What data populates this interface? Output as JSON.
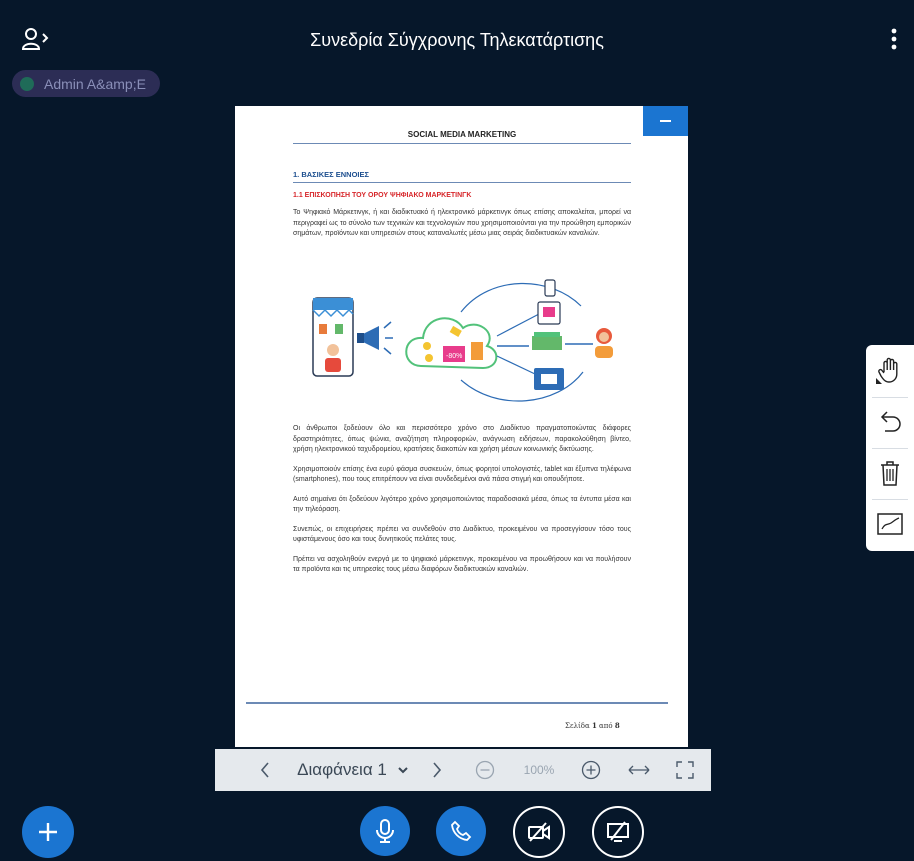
{
  "header": {
    "title": "Συνεδρία Σύγχρονης Τηλεκατάρτισης",
    "users_icon": "users-toggle-icon",
    "menu_icon": "more-vertical-icon"
  },
  "user_pill": {
    "name": "Admin A&amp;E",
    "status_color": "#1f6b58"
  },
  "slide": {
    "doc_title": "SOCIAL MEDIA MARKETING",
    "section_heading": "1. ΒΑΣΙΚΕΣ ΕΝΝΟΙΕΣ",
    "subsection_heading": "1.1 ΕΠΙΣΚΟΠΗΣΗ ΤΟΥ ΟΡΟΥ ΨΗΦΙΑΚΟ ΜΑΡΚΕΤΙΝΓΚ",
    "intro_paragraph": "Το Ψηφιακό Μάρκετινγκ, ή και διαδικτυακό ή ηλεκτρονικό μάρκετινγκ όπως επίσης αποκαλείται, μπορεί να περιγραφεί ως το σύνολο των τεχνικών και τεχνολογιών που χρησιμοποιούνται για την προώθηση εμπορικών σημάτων, προϊόντων και υπηρεσιών στους καταναλωτές μέσω μιας σειράς διαδικτυακών καναλιών.",
    "illustration_discount": "-80%",
    "paragraphs": [
      "Οι άνθρωποι ξοδεύουν όλο και περισσότερο χρόνο στο Διαδίκτυο πραγματοποιώντας διάφορες δραστηριότητες, όπως ψώνια, αναζήτηση πληροφοριών, ανάγνωση ειδήσεων, παρακολούθηση βίντεο, χρήση ηλεκτρονικού ταχυδρομείου, κρατήσεις διακοπών και χρήση μέσων κοινωνικής δικτύωσης.",
      "Χρησιμοποιούν επίσης ένα ευρύ φάσμα συσκευών, όπως φορητοί υπολογιστές, tablet και έξυπνα τηλέφωνα (smartphones), που τους επιτρέπουν να είναι συνδεδεμένοι ανά πάσα στιγμή και οπουδήποτε.",
      "Αυτό σημαίνει ότι ξοδεύουν λιγότερο χρόνο χρησιμοποιώντας παραδοσιακά μέσα, όπως τα έντυπα μέσα και την τηλεόραση.",
      "Συνεπώς, οι επιχειρήσεις πρέπει να συνδεθούν στο Διαδίκτυο, προκειμένου να προσεγγίσουν τόσο τους υφιστάμενους όσο και τους δυνητικούς πελάτες τους.",
      "Πρέπει να ασχοληθούν ενεργά με το ψηφιακό μάρκετινγκ, προκειμένου να προωθήσουν και να πουλήσουν τα προϊόντα και τις υπηρεσίες τους μέσω διαφόρων διαδικτυακών καναλιών."
    ],
    "page_prefix": "Σελίδα ",
    "page_current": "1",
    "page_mid": " από ",
    "page_total": "8"
  },
  "toolbar": {
    "slide_label": "Διαφάνεια 1",
    "zoom": "100%"
  },
  "tools": [
    "hand-tool-icon",
    "undo-icon",
    "trash-icon",
    "whiteboard-multiuser-icon"
  ],
  "actions": [
    "add-icon",
    "microphone-icon",
    "phone-icon",
    "camera-off-icon",
    "screenshare-off-icon"
  ],
  "colors": {
    "background": "#06172a",
    "accent": "#1b75d1",
    "toolbar": "#e5e9ed",
    "heading_blue": "#1d4f8f",
    "heading_red": "#d7262a"
  }
}
